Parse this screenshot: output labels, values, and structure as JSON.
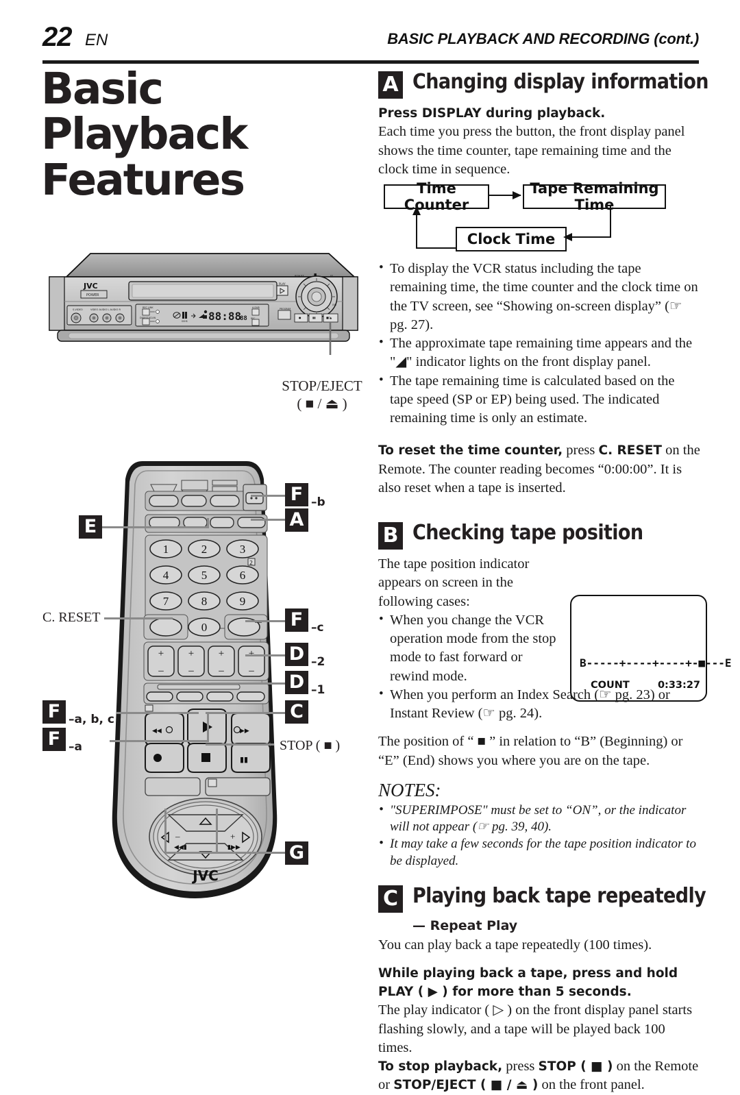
{
  "header": {
    "page_number": "22",
    "locale": "EN",
    "breadcrumb": "BASIC PLAYBACK AND RECORDING (cont.)"
  },
  "chapter_title": {
    "line1": "Basic",
    "line2": "Playback",
    "line3": "Features"
  },
  "vcr_illustration": {
    "brand": "JVC",
    "power_label": "POWER",
    "play_label": "PLAY",
    "callout_label": "STOP/EJECT",
    "callout_symbols": "( ■ / ⏏ )"
  },
  "remote_illustration": {
    "brand": "JVC",
    "keypad": [
      "1",
      "2",
      "3",
      "4",
      "5",
      "6",
      "7",
      "8",
      "9",
      "0"
    ],
    "callouts": {
      "f_b": {
        "letter": "F",
        "suffix": "–b"
      },
      "a": {
        "letter": "A",
        "suffix": ""
      },
      "e": {
        "letter": "E",
        "suffix": ""
      },
      "c_reset": {
        "label": "C. RESET"
      },
      "f_c": {
        "letter": "F",
        "suffix": "–c"
      },
      "d_2": {
        "letter": "D",
        "suffix": "–2"
      },
      "d_1": {
        "letter": "D",
        "suffix": "–1"
      },
      "f_abc": {
        "letter": "F",
        "suffix": "–a, b, c"
      },
      "f_a": {
        "letter": "F",
        "suffix": "–a"
      },
      "c": {
        "letter": "C",
        "suffix": ""
      },
      "stop": {
        "label": "STOP ( ■ )"
      },
      "g": {
        "letter": "G",
        "suffix": ""
      }
    }
  },
  "section_a": {
    "letter": "A",
    "title": "Changing display information",
    "lead_bold": "Press DISPLAY during playback.",
    "lead_body": "Each time you press the button, the front display panel shows the time counter, tape remaining time and the clock time in sequence.",
    "flow": {
      "box1": "Time Counter",
      "box2": "Tape Remaining Time",
      "box3": "Clock Time"
    },
    "bullets": [
      "To display the VCR status including the tape remaining time, the time counter and the clock time on the TV screen, see “Showing on-screen display”  (☞ pg. 27).",
      "The approximate tape remaining time appears and the \"◢\" indicator lights on the front display panel.",
      "The tape remaining time is calculated based on the tape speed (SP or EP) being used. The indicated remaining time is only an estimate."
    ],
    "reset_bold": "To reset the time counter,",
    "reset_text_1": " press ",
    "reset_bold_2": "C. RESET",
    "reset_text_2": " on the Remote. The counter reading becomes “0:00:00”. It is also reset when a tape is inserted."
  },
  "section_b": {
    "letter": "B",
    "title": "Checking tape position",
    "intro": "The tape position indicator appears on screen in the following cases:",
    "bullets": [
      "When you change the VCR operation mode from the stop mode to fast forward or rewind mode.",
      "When you perform an Index Search (☞ pg. 23) or Instant Review (☞ pg. 24)."
    ],
    "closing": "The position of “ ■ ” in relation to “B” (Beginning) or “E” (End) shows you where you are on the tape.",
    "tv_screen": {
      "position_bar": "B-----+----+----+-■---E",
      "count_label": "COUNT",
      "count_value": "0:33:27"
    }
  },
  "notes": {
    "title": "NOTES:",
    "items": [
      "\"SUPERIMPOSE\" must be set to “ON”, or the indicator will not appear (☞ pg. 39, 40).",
      "It may take a few seconds for the tape position indicator to be displayed."
    ]
  },
  "section_c": {
    "letter": "C",
    "title": "Playing back tape repeatedly",
    "subtitle": "— Repeat Play",
    "intro": "You can play back a tape repeatedly (100 times).",
    "instruction_bold": "While playing back a tape, press and hold PLAY ( ▶ ) for more than 5 seconds.",
    "body": "The play indicator ( ▷ ) on the front display panel starts flashing slowly, and a tape will be played back 100 times.",
    "stop_bold": "To stop playback,",
    "stop_mid": " press ",
    "stop_bold_2": "STOP ( ■ )",
    "stop_text": " on the Remote or ",
    "stop_bold_3": "STOP/EJECT ( ■ / ⏏ )",
    "stop_tail": " on the front panel."
  }
}
